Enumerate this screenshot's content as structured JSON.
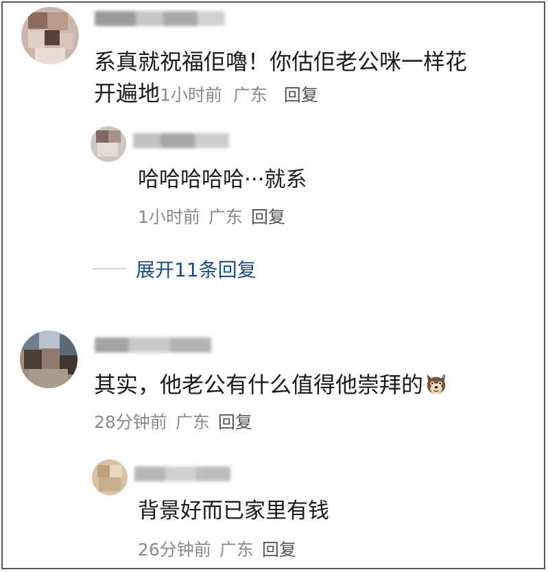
{
  "comments": [
    {
      "text_line1": "系真就祝福佢嚕！你估佢老公咪一样花",
      "text_line2": "开遍地",
      "time": "1小时前",
      "location": "广东",
      "reply_label": "回复",
      "replies": [
        {
          "text": "哈哈哈哈哈···就系",
          "time": "1小时前",
          "location": "广东",
          "reply_label": "回复"
        }
      ],
      "expand_label": "展开11条回复"
    },
    {
      "text": "其实，他老公有什么值得他崇拜的",
      "emoji": "dog-sweat-emoji",
      "time": "28分钟前",
      "location": "广东",
      "reply_label": "回复",
      "replies": [
        {
          "text": "背景好而已家里有钱",
          "time": "26分钟前",
          "location": "广东",
          "reply_label": "回复"
        }
      ]
    }
  ],
  "colors": {
    "text": "#1a1a1a",
    "meta": "#8a8a8a",
    "link": "#1f4a7c",
    "frame": "#555555"
  }
}
